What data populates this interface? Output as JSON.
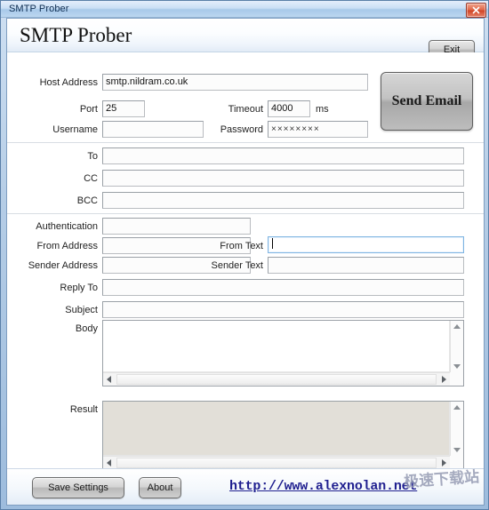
{
  "window": {
    "title": "SMTP Prober",
    "close_icon": "close-icon"
  },
  "header": {
    "app_title": "SMTP Prober",
    "exit_label": "Exit"
  },
  "connection": {
    "host_label": "Host Address",
    "host_value": "smtp.nildram.co.uk",
    "port_label": "Port",
    "port_value": "25",
    "timeout_label": "Timeout",
    "timeout_value": "4000",
    "timeout_unit": "ms",
    "username_label": "Username",
    "username_value": "",
    "password_label": "Password",
    "password_value": "××××××××",
    "send_label": "Send Email"
  },
  "recipients": {
    "to_label": "To",
    "to_value": "",
    "cc_label": "CC",
    "cc_value": "",
    "bcc_label": "BCC",
    "bcc_value": ""
  },
  "message": {
    "authentication_label": "Authentication",
    "authentication_value": "",
    "from_address_label": "From Address",
    "from_address_value": "",
    "from_text_label": "From Text",
    "from_text_value": "",
    "sender_address_label": "Sender Address",
    "sender_address_value": "",
    "sender_text_label": "Sender Text",
    "sender_text_value": "",
    "reply_to_label": "Reply To",
    "reply_to_value": "",
    "subject_label": "Subject",
    "subject_value": "",
    "body_label": "Body",
    "body_value": ""
  },
  "result": {
    "label": "Result",
    "value": ""
  },
  "footer": {
    "save_label": "Save Settings",
    "about_label": "About",
    "site_url": "http://www.alexnolan.net"
  },
  "watermark": {
    "text": "极速下载站"
  },
  "colors": {
    "frame": "#9dbcdd",
    "focus_border": "#7eb4e2",
    "link": "#1f1f8f",
    "disabled_bg": "#e2dfd8"
  }
}
